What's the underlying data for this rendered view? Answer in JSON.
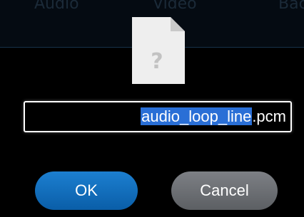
{
  "background_tabs": [
    "Audio",
    "Video",
    "Bac"
  ],
  "dialog": {
    "icon": "unknown-file-icon",
    "icon_glyph": "?",
    "filename": {
      "selected_part": "audio_loop_line",
      "extension": ".pcm"
    },
    "buttons": {
      "ok_label": "OK",
      "cancel_label": "Cancel"
    }
  },
  "colors": {
    "selection": "#2a6fd6",
    "ok_button": "#1574c2",
    "cancel_button": "#6d7075",
    "background": "#000000"
  }
}
